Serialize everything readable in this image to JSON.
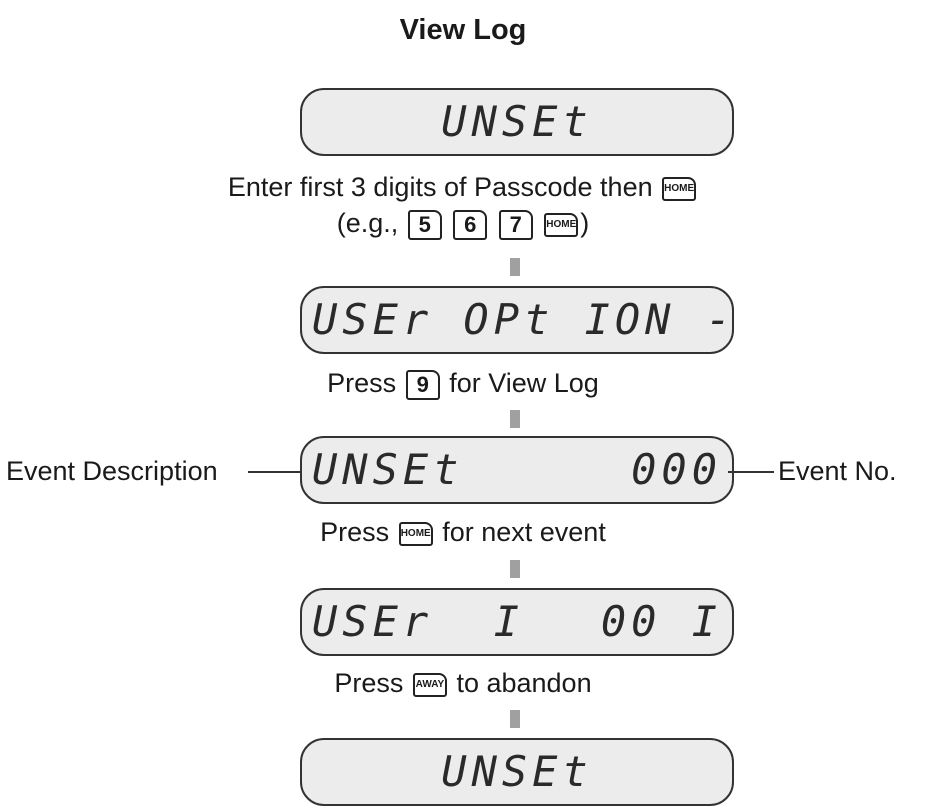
{
  "title": "View Log",
  "displays": [
    {
      "text": "UNSEt"
    },
    {
      "text": "USEr OPt ION -"
    },
    {
      "left": "UNSEt",
      "right": "000"
    },
    {
      "left": "USEr  I",
      "right": "00 I"
    },
    {
      "text": "UNSEt"
    }
  ],
  "steps": {
    "step1": {
      "line1_text": "Enter first 3 digits of Passcode then",
      "line1_key": "HOME",
      "line2_prefix": "(e.g.,",
      "keys": [
        "5",
        "6",
        "7"
      ],
      "line2_key": "HOME",
      "line2_suffix": ")"
    },
    "step2": {
      "prefix": "Press",
      "key": "9",
      "suffix": "for View Log"
    },
    "step3": {
      "prefix": "Press",
      "key": "HOME",
      "suffix": "for next event"
    },
    "step4": {
      "prefix": "Press",
      "key": "AWAY",
      "suffix": "to abandon"
    }
  },
  "labels": {
    "event_description": "Event Description",
    "event_no": "Event No."
  }
}
